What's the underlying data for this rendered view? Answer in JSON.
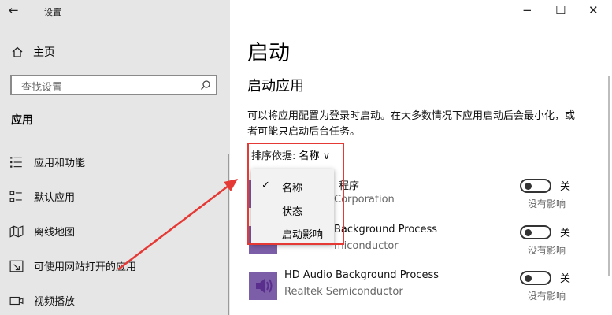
{
  "window": {
    "title": "设置",
    "back_glyph": "←",
    "minimize_glyph": "−",
    "maximize_glyph": "☐",
    "close_glyph": "✕"
  },
  "sidebar": {
    "home_label": "主页",
    "search_placeholder": "查找设置",
    "section_label": "应用",
    "items": [
      {
        "label": "应用和功能",
        "icon": "list-icon"
      },
      {
        "label": "默认应用",
        "icon": "default-apps-icon"
      },
      {
        "label": "离线地图",
        "icon": "map-icon"
      },
      {
        "label": "可使用网站打开的应用",
        "icon": "open-website-icon"
      },
      {
        "label": "视频播放",
        "icon": "video-icon"
      }
    ]
  },
  "main": {
    "page_title": "启动",
    "subtitle": "启动应用",
    "description": "可以将应用配置为登录时启动。在大多数情况下应用启动后会最小化，或者可能只启动后台任务。",
    "sort_label": "排序依据:",
    "sort_value": "名称",
    "sort_chevron": "∨",
    "sort_menu": [
      {
        "label": "名称",
        "checked": true
      },
      {
        "label": "状态",
        "checked": false
      },
      {
        "label": "启动影响",
        "checked": false
      }
    ],
    "apps": [
      {
        "name": "程序",
        "publisher": "Corporation",
        "state": "关",
        "impact": "没有影响",
        "on": false
      },
      {
        "name": "Background Process",
        "publisher": "miconductor",
        "state": "关",
        "impact": "没有影响",
        "on": false
      },
      {
        "name": "HD Audio Background Process",
        "publisher": "Realtek Semiconductor",
        "state": "关",
        "impact": "没有影响",
        "on": false
      }
    ]
  },
  "colors": {
    "sidebar_bg": "#e6e6e6",
    "annotation_red": "#e53935",
    "app_icon_purple": "#7b5ea7"
  }
}
